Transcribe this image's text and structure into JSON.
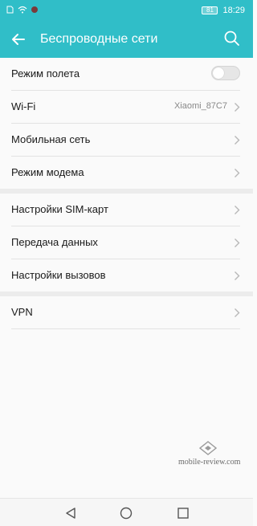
{
  "status_bar": {
    "battery": "81",
    "time": "18:29"
  },
  "toolbar": {
    "title": "Беспроводные сети"
  },
  "groups": [
    {
      "items": [
        {
          "label": "Режим полета",
          "type": "toggle",
          "on": false
        },
        {
          "label": "Wi-Fi",
          "value": "Xiaomi_87C7"
        },
        {
          "label": "Мобильная сеть"
        },
        {
          "label": "Режим модема"
        }
      ]
    },
    {
      "items": [
        {
          "label": "Настройки SIM-карт"
        },
        {
          "label": "Передача данных"
        },
        {
          "label": "Настройки вызовов"
        }
      ]
    },
    {
      "items": [
        {
          "label": "VPN"
        }
      ]
    }
  ],
  "watermark": {
    "text": "mobile-review.com"
  },
  "icons": {
    "back": "arrow-left-icon",
    "search": "search-icon",
    "chevron": "chevron-right-icon",
    "nav_back": "triangle-back-icon",
    "nav_home": "circle-home-icon",
    "nav_recent": "square-recent-icon"
  },
  "colors": {
    "accent": "#30bec8",
    "background": "#fafafa",
    "separator": "#ececec"
  }
}
